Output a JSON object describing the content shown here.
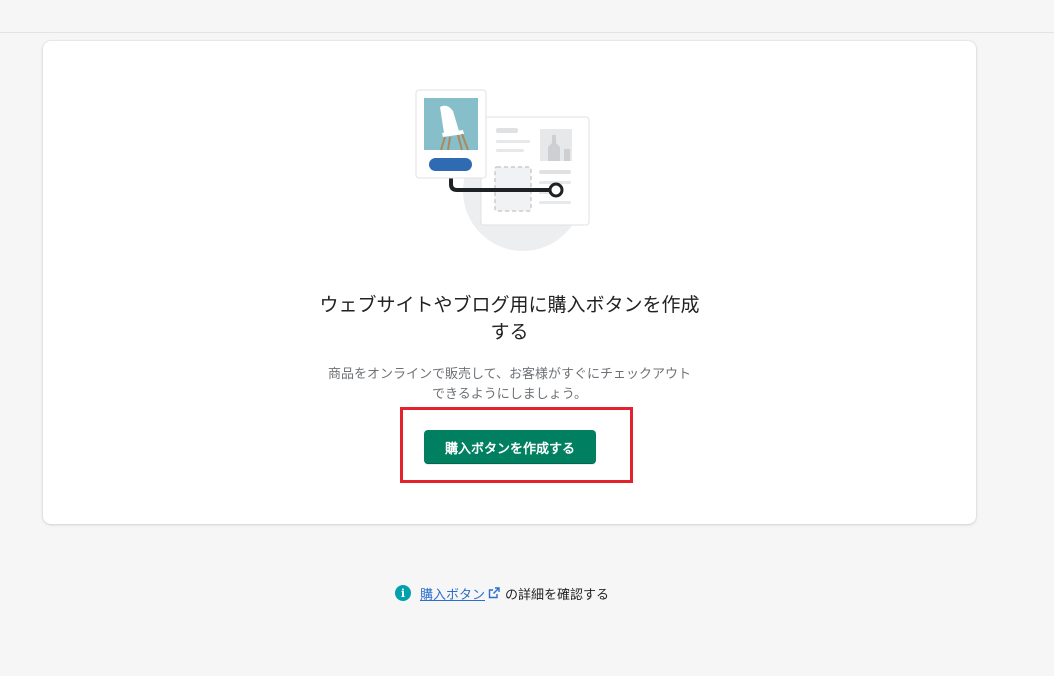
{
  "empty_state": {
    "heading": "ウェブサイトやブログ用に購入ボタンを作成する",
    "heading_line1": "ウェブサイトやブログ用に購入ボタンを作成",
    "heading_line2": "する",
    "description_line1": "商品をオンラインで販売して、お客様がすぐにチェックアウト",
    "description_line2": "できるようにしましょう。",
    "primary_action_label": "購入ボタンを作成する"
  },
  "footer": {
    "info_icon": "info-icon",
    "link_label": "購入ボタン",
    "link_external_icon": "external-link-icon",
    "suffix": "の詳細を確認する"
  },
  "colors": {
    "primary": "#008060",
    "highlight": "#e3212f",
    "link": "#2c6ecb",
    "info": "#00a0ac"
  }
}
